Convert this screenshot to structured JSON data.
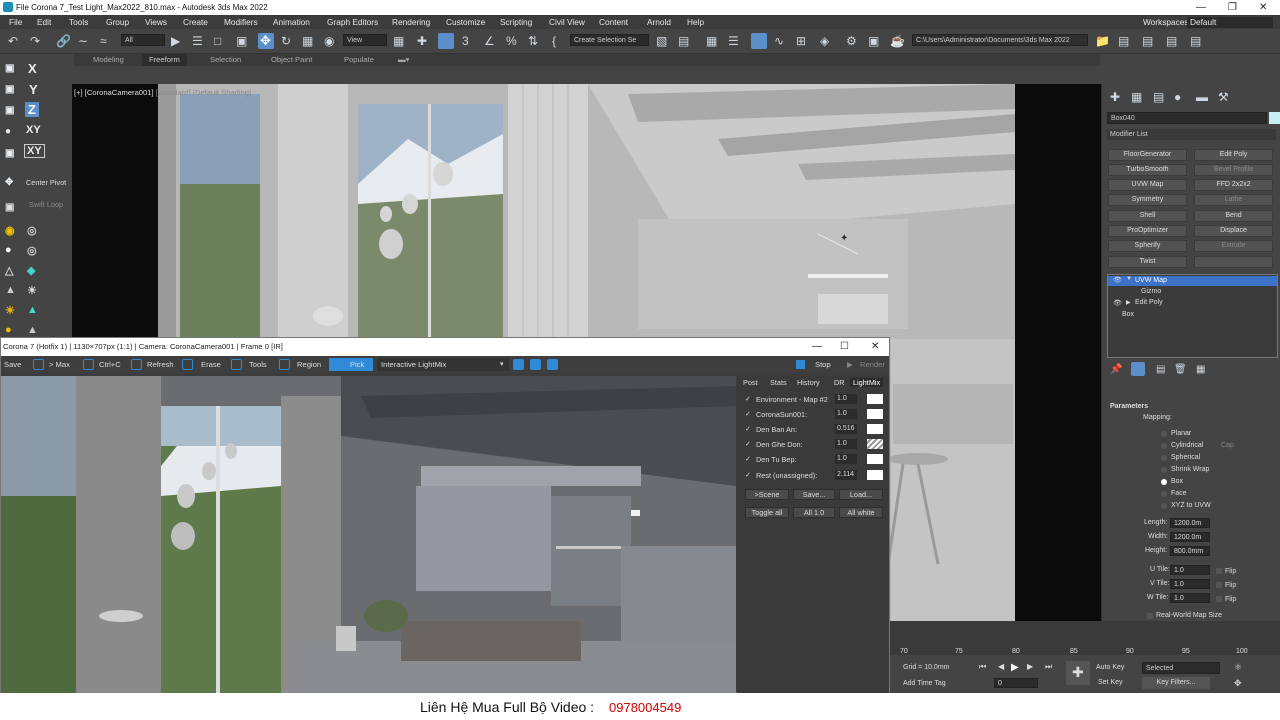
{
  "app": {
    "window_title": "File Corona 7_Test Light_Max2022_810.max - Autodesk 3ds Max 2022",
    "workspaces_label": "Workspaces:",
    "workspaces_value": "Default"
  },
  "menu": [
    "File",
    "Edit",
    "Tools",
    "Group",
    "Views",
    "Create",
    "Modifiers",
    "Animation",
    "Graph Editors",
    "Rendering",
    "Customize",
    "Scripting",
    "Civil View",
    "Content",
    "Arnold",
    "Help"
  ],
  "toolbar": {
    "selection_filter": "All",
    "ref_coord": "View",
    "named_selection": "Create Selection Se",
    "project_path": "C:\\Users\\Administrator\\Documents\\3ds Max 2022"
  },
  "ribbon": [
    "Modeling",
    "Freeform",
    "Selection",
    "Object Paint",
    "Populate"
  ],
  "leftbar": {
    "axes": [
      "X",
      "Y",
      "Z",
      "XY",
      "XY"
    ],
    "center_pivot": "Center Pivot",
    "swift_loop": "Swift Loop"
  },
  "viewport": {
    "label_main": "[+] [CoronaCamera001]",
    "label_extra": "[Standard] [Default Shading]"
  },
  "command_panel": {
    "object_name": "Box040",
    "modifier_list": "Modifier List",
    "modifier_buttons": [
      {
        "label": "FloorGenerator",
        "enabled": true
      },
      {
        "label": "Edit Poly",
        "enabled": true
      },
      {
        "label": "TurboSmooth",
        "enabled": true
      },
      {
        "label": "Bevel Profile",
        "enabled": false
      },
      {
        "label": "UVW Map",
        "enabled": true
      },
      {
        "label": "FFD 2x2x2",
        "enabled": true
      },
      {
        "label": "Symmetry",
        "enabled": true
      },
      {
        "label": "Lathe",
        "enabled": false
      },
      {
        "label": "Shell",
        "enabled": true
      },
      {
        "label": "Bend",
        "enabled": true
      },
      {
        "label": "ProOptimizer",
        "enabled": true
      },
      {
        "label": "Displace",
        "enabled": true
      },
      {
        "label": "Spherify",
        "enabled": true
      },
      {
        "label": "Extrude",
        "enabled": false
      },
      {
        "label": "Twist",
        "enabled": true
      },
      {
        "label": "",
        "enabled": false
      }
    ],
    "stack": [
      {
        "label": "UVW Map",
        "selected": true
      },
      {
        "label": "Gizmo",
        "selected": false
      },
      {
        "label": "Edit Poly",
        "selected": false
      },
      {
        "label": "Box",
        "selected": false
      }
    ],
    "parameters": {
      "title": "Parameters",
      "mapping_label": "Mapping:",
      "mapping_options": [
        {
          "label": "Planar",
          "checked": false
        },
        {
          "label": "Cylindrical",
          "checked": false,
          "extra": "Cap"
        },
        {
          "label": "Spherical",
          "checked": false
        },
        {
          "label": "Shrink Wrap",
          "checked": false
        },
        {
          "label": "Box",
          "checked": true
        },
        {
          "label": "Face",
          "checked": false
        },
        {
          "label": "XYZ to UVW",
          "checked": false
        }
      ],
      "length_label": "Length:",
      "length": "1200.0m",
      "width_label": "Width:",
      "width": "1200.0m",
      "height_label": "Height:",
      "height": "800.0mm",
      "utile_label": "U Tile:",
      "utile": "1.0",
      "vtile_label": "V Tile:",
      "vtile": "1.0",
      "wtile_label": "W Tile:",
      "wtile": "1.0",
      "flip": "Flip",
      "realworld": "Real-World Map Size"
    }
  },
  "corona": {
    "title": "Corona 7 (Hotfix 1) | 1130×707px (1:1) | Camera: CoronaCamera001 | Frame 0 [IR]",
    "toolbar": [
      "Save",
      "> Max",
      "Ctrl+C",
      "Refresh",
      "Erase",
      "Tools",
      "Region",
      "Pick",
      "Interactive LightMix"
    ],
    "stop": "Stop",
    "render": "Render",
    "tabs": [
      "Post",
      "Stats",
      "History",
      "DR",
      "LightMix"
    ],
    "lightmix": [
      {
        "name": "Environment - Map #2",
        "checked": true,
        "value": "1.0",
        "color": "#ffffff"
      },
      {
        "name": "CoronaSun001:",
        "checked": true,
        "value": "1.0",
        "color": "#ffffff"
      },
      {
        "name": "Den Ban An:",
        "checked": true,
        "value": "0.516",
        "color": "#ffffff"
      },
      {
        "name": "Den Ghe Don:",
        "checked": true,
        "value": "1.0",
        "color": "#dddddd"
      },
      {
        "name": "Den Tu Bep:",
        "checked": true,
        "value": "1.0",
        "color": "#ffffff"
      },
      {
        "name": "Rest (unassigned):",
        "checked": true,
        "value": "2.114",
        "color": "#ffffff"
      }
    ],
    "btn_scene": ">Scene",
    "btn_save": "Save...",
    "btn_load": "Load...",
    "btn_toggle": "Toggle all",
    "btn_all1": "All 1.0",
    "btn_white": "All white"
  },
  "timeline": {
    "ticks": [
      "70",
      "75",
      "80",
      "85",
      "90",
      "95",
      "100"
    ],
    "grid": "Grid = 10.0mm",
    "add_time_tag": "Add Time Tag",
    "frame": "0",
    "auto_key": "Auto Key",
    "auto_key_mode": "Selected",
    "set_key": "Set Key",
    "key_filters": "Key Filters..."
  },
  "footer": {
    "contact": "Liên Hệ Mua Full Bộ Video :",
    "phone": "0978004549"
  },
  "colors": {
    "accent": "#2f8ad8",
    "selected": "#3c72c8",
    "phone": "#d40000"
  }
}
